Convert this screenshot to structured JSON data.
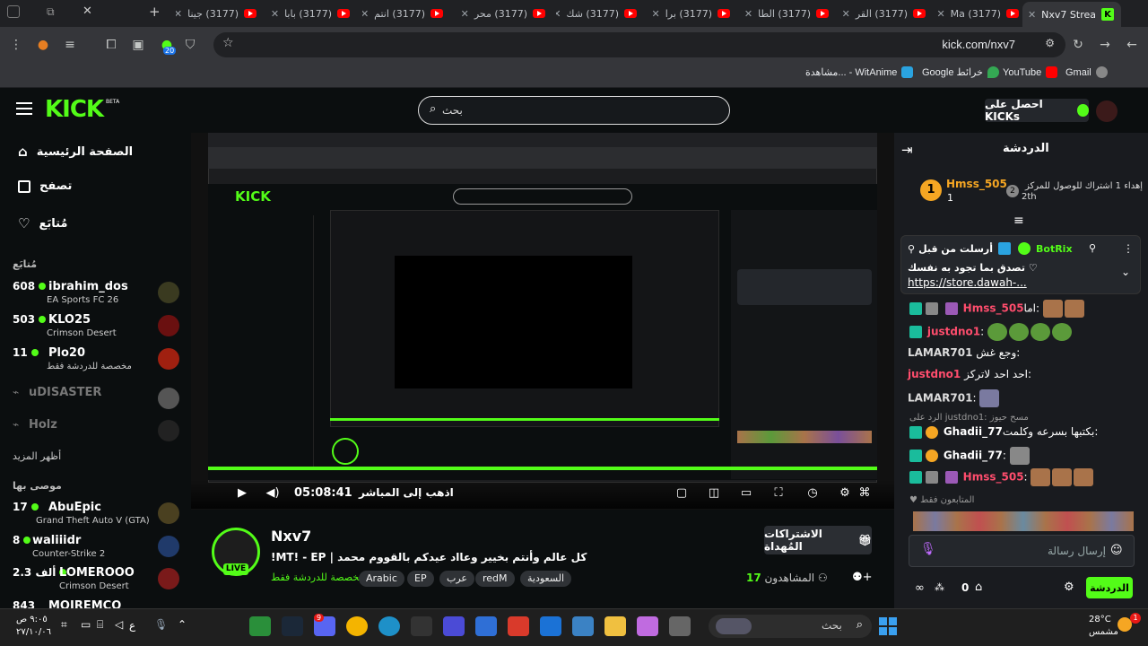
{
  "browser": {
    "tabs": [
      {
        "label": "(3177) جينا"
      },
      {
        "label": "(3177) بابا"
      },
      {
        "label": "(3177) انتم"
      },
      {
        "label": "(3177) محر"
      },
      {
        "label": "(3177) شك"
      },
      {
        "label": "(3177) برا"
      },
      {
        "label": "(3177) الطا"
      },
      {
        "label": "(3177) القر"
      },
      {
        "label": "(3177) Ma"
      }
    ],
    "active_tab": "Nxv7 Strea",
    "url": "kick.com/nxv7",
    "extension_badge": "20",
    "bookmarks": [
      {
        "label": "Gmail"
      },
      {
        "label": "YouTube"
      },
      {
        "label": "Google خرائط"
      },
      {
        "label": "مشاهدة... - WitAnime"
      }
    ]
  },
  "header": {
    "logo": "KICK",
    "beta": "BETA",
    "search_placeholder": "بحث",
    "kicks_button": "احصل على KICKs"
  },
  "sidebar": {
    "nav": [
      {
        "label": "الصفحة الرئيسية",
        "icon": "home-icon"
      },
      {
        "label": "تصفح",
        "icon": "browse-icon"
      },
      {
        "label": "مُتابَع",
        "icon": "heart-icon"
      }
    ],
    "following_title": "مُتابَع",
    "following": [
      {
        "count": "608",
        "name": "ibrahim_dos",
        "sub": "EA Sports FC 26"
      },
      {
        "count": "503",
        "name": "KLO25",
        "sub": "Crimson Desert"
      },
      {
        "count": "11",
        "name": "Plo20",
        "sub": "مخصصة للدردشة فقط"
      },
      {
        "count": "",
        "name": "uDISASTER",
        "sub": ""
      },
      {
        "count": "",
        "name": "Holz",
        "sub": ""
      }
    ],
    "show_more": "أظهر المزيد",
    "recommended_title": "موصى بها",
    "recommended": [
      {
        "count": "17",
        "name": "AbuEpic",
        "sub": "Grand Theft Auto V (GTA)"
      },
      {
        "count": "8",
        "name": "waliiidr",
        "sub": "Counter-Strike 2"
      },
      {
        "count": "2.3 ألف",
        "name": "LOMEROOO",
        "sub": "Crimson Desert"
      },
      {
        "count": "843",
        "name": "MOJREMCO",
        "sub": ""
      }
    ]
  },
  "player": {
    "time": "05:08:41",
    "go_live": "اذهب إلى المباشر"
  },
  "stream": {
    "name": "Nxv7",
    "live": "LIVE",
    "title": "كل عالم وأنتم بخيير وعااد عيدكم بالقووم محمد | MT! - EP!",
    "category": "مخصصة للدردشة فقط",
    "tags": [
      "Arabic",
      "EP",
      "عرب",
      "redM",
      "السعودية"
    ],
    "subs_button": "الاشتراكات المُهداة",
    "viewers_label": "المشاهدون",
    "viewers_count": "17"
  },
  "chat": {
    "title": "الدردشة",
    "leader": {
      "rank": "1",
      "name": "Hmss_505",
      "count": "1",
      "text": "إهداء 1 اشتراك للوصول للمركز",
      "second_rank": "2",
      "second": "2th"
    },
    "pinned": {
      "by": "أرسلت من قبل",
      "user": "BotRix",
      "text": "تصدق بما تجود به نفسك",
      "link": "https://store.dawah-..."
    },
    "messages": [
      {
        "user": "Hmss_505",
        "text": "اما:",
        "color": "#ff4d6d"
      },
      {
        "user": "justdno1",
        "text": ":",
        "color": "#ff4d6d"
      },
      {
        "user": "LAMAR701",
        "text": "وجع غش:",
        "color": "#dddddd"
      },
      {
        "user": "justdno1",
        "text": "احد احد لاتركز:",
        "color": "#ff4d6d"
      },
      {
        "user": "LAMAR701",
        "text": ":",
        "color": "#dddddd"
      },
      {
        "user": "Ghadii_77",
        "text": "بكتبها بسرعه وكلمت:",
        "color": "#dddddd",
        "reply": "الرد على justdno1: مسح حيوز"
      },
      {
        "user": "Ghadii_77",
        "text": ":",
        "color": "#dddddd"
      },
      {
        "user": "Hmss_505",
        "text": ":",
        "color": "#ff4d6d"
      }
    ],
    "followers_only": "المتابعون فقط",
    "input_placeholder": "إرسال رسالة",
    "points": "0",
    "send_button": "الدردشة"
  },
  "taskbar": {
    "search": "بحث",
    "time": "٩:٠٥ ص",
    "date": "٢٧/١٠/٠٦",
    "lang": "ع",
    "temp": "28°C",
    "weather": "مشمس",
    "notif": "1",
    "discord_badge": "9"
  }
}
